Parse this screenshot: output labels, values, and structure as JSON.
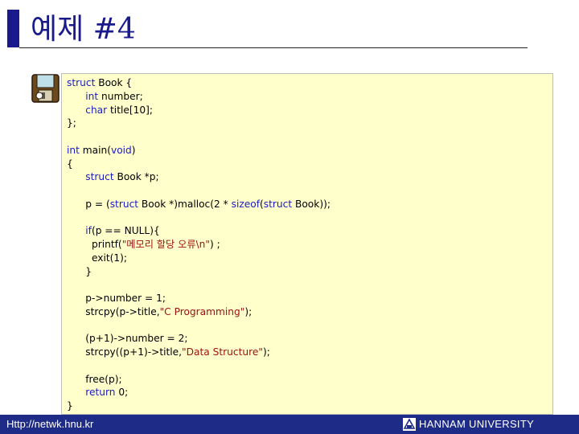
{
  "slide": {
    "title": "예제 #4"
  },
  "code": {
    "lines": [
      [
        {
          "t": "struct",
          "k": "kw"
        },
        {
          "t": " Book {"
        }
      ],
      [
        {
          "t": "      "
        },
        {
          "t": "int",
          "k": "kw"
        },
        {
          "t": " number;"
        }
      ],
      [
        {
          "t": "      "
        },
        {
          "t": "char",
          "k": "kw"
        },
        {
          "t": " title[10];"
        }
      ],
      [
        {
          "t": "};"
        }
      ],
      [],
      [
        {
          "t": "int",
          "k": "kw"
        },
        {
          "t": " main("
        },
        {
          "t": "void",
          "k": "kw"
        },
        {
          "t": ")"
        }
      ],
      [
        {
          "t": "{"
        }
      ],
      [
        {
          "t": "      "
        },
        {
          "t": "struct",
          "k": "kw"
        },
        {
          "t": " Book *p;"
        }
      ],
      [],
      [
        {
          "t": "      p = ("
        },
        {
          "t": "struct",
          "k": "kw"
        },
        {
          "t": " Book *)malloc(2 * "
        },
        {
          "t": "sizeof",
          "k": "kw"
        },
        {
          "t": "("
        },
        {
          "t": "struct",
          "k": "kw"
        },
        {
          "t": " Book));"
        }
      ],
      [],
      [
        {
          "t": "      "
        },
        {
          "t": "if",
          "k": "kw"
        },
        {
          "t": "(p == NULL){"
        }
      ],
      [
        {
          "t": "        printf("
        },
        {
          "t": "\"메모리 할당 오류\\n\"",
          "k": "str"
        },
        {
          "t": ") ;"
        }
      ],
      [
        {
          "t": "        exit(1);"
        }
      ],
      [
        {
          "t": "      }"
        }
      ],
      [],
      [
        {
          "t": "      p->number = 1;"
        }
      ],
      [
        {
          "t": "      strcpy(p->title,"
        },
        {
          "t": "\"C Programming\"",
          "k": "str"
        },
        {
          "t": ");"
        }
      ],
      [],
      [
        {
          "t": "      (p+1)->number = 2;"
        }
      ],
      [
        {
          "t": "      strcpy((p+1)->title,"
        },
        {
          "t": "\"Data Structure\"",
          "k": "str"
        },
        {
          "t": ");"
        }
      ],
      [],
      [
        {
          "t": "      free(p);"
        }
      ],
      [
        {
          "t": "      "
        },
        {
          "t": "return",
          "k": "kw"
        },
        {
          "t": " 0;"
        }
      ],
      [
        {
          "t": "}"
        }
      ]
    ]
  },
  "footer": {
    "url": "Http://netwk.hnu.kr",
    "university": "HANNAM UNIVERSITY",
    "color": "#1f2c87"
  },
  "icons": {
    "example": "floppy-disk-icon",
    "university_logo": "hannam-logo-icon"
  }
}
